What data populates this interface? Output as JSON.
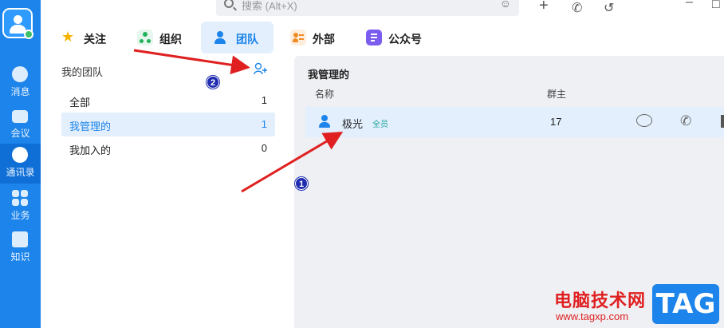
{
  "search": {
    "placeholder": "搜索 (Alt+X)"
  },
  "top_icons": [
    "chatbot-icon",
    "plus-icon",
    "call-icon",
    "history-icon",
    "minimize-icon",
    "maximize-icon"
  ],
  "rail": {
    "items": [
      {
        "label": "消息",
        "icon": "chat-icon"
      },
      {
        "label": "会议",
        "icon": "video-icon"
      },
      {
        "label": "通讯录",
        "icon": "contacts-icon",
        "active": true
      },
      {
        "label": "业务",
        "icon": "apps-icon"
      },
      {
        "label": "知识",
        "icon": "book-icon"
      }
    ]
  },
  "tabs": [
    {
      "label": "关注",
      "icon": "star-icon",
      "color": "#f5b400"
    },
    {
      "label": "组织",
      "icon": "org-icon",
      "color": "#20b15a"
    },
    {
      "label": "团队",
      "icon": "team-icon",
      "color": "#1c84ea",
      "active": true
    },
    {
      "label": "外部",
      "icon": "external-icon",
      "color": "#f08a24"
    },
    {
      "label": "公众号",
      "icon": "official-account-icon",
      "color": "#7b5cf0"
    }
  ],
  "left_panel": {
    "title": "我的团队",
    "filters": [
      {
        "label": "全部",
        "count": "1"
      },
      {
        "label": "我管理的",
        "count": "1",
        "active": true
      },
      {
        "label": "我加入的",
        "count": "0"
      }
    ]
  },
  "main": {
    "section_title": "我管理的",
    "columns": {
      "name": "名称",
      "owner": "群主"
    },
    "rows": [
      {
        "name": "极光",
        "badge": "全员",
        "owner": "17"
      }
    ]
  },
  "annotations": {
    "marker1": "1",
    "marker2": "2"
  },
  "watermark": {
    "text": "电脑技术网",
    "url": "www.tagxp.com",
    "tag": "TAG"
  },
  "colors": {
    "accent": "#1c84ea",
    "rail": "#1c84ea",
    "arrow": "#e02020",
    "marker": "#1f2bb0"
  }
}
